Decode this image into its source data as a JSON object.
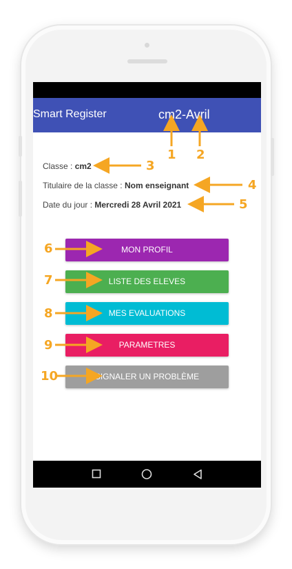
{
  "app": {
    "title": "Smart Register",
    "subtitle": "cm2-Avril"
  },
  "info": {
    "classe_label": "Classe : ",
    "classe_value": "cm2",
    "titulaire_label": "Titulaire de la classe : ",
    "titulaire_value": "Nom enseignant",
    "date_label": "Date du jour : ",
    "date_value": "Mercredi 28 Avril 2021"
  },
  "buttons": [
    {
      "label": "MON PROFIL",
      "color": "#9c27b0"
    },
    {
      "label": "LISTE DES ELEVES",
      "color": "#4caf50"
    },
    {
      "label": "MES EVALUATIONS",
      "color": "#00bcd4"
    },
    {
      "label": "PARAMETRES",
      "color": "#e91e63"
    },
    {
      "label": "SIGNALER UN PROBLÈME",
      "color": "#9e9e9e"
    }
  ],
  "nav": {
    "icons": [
      "square-icon",
      "circle-icon",
      "back-triangle-icon"
    ]
  },
  "annotations": [
    "1",
    "2",
    "3",
    "4",
    "5",
    "6",
    "7",
    "8",
    "9",
    "10"
  ],
  "colors": {
    "appbar": "#3f51b5",
    "annotation": "#f5a623"
  }
}
